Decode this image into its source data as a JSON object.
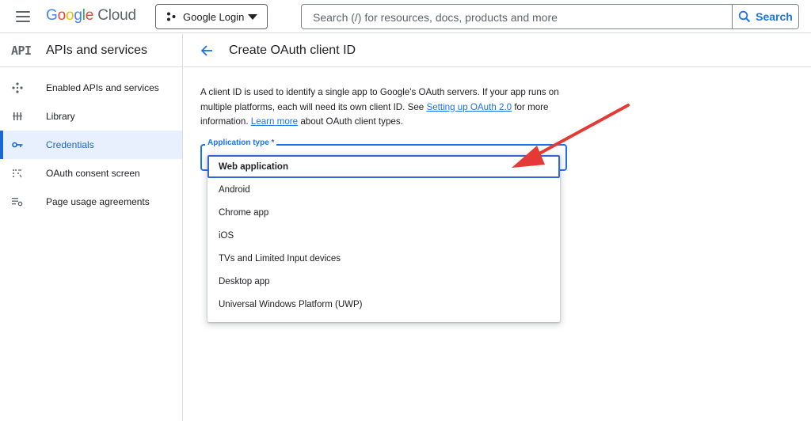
{
  "header": {
    "logo": {
      "g": "G",
      "o1": "o",
      "o2": "o",
      "g2": "g",
      "l": "l",
      "e": "e",
      "cloud": "Cloud"
    },
    "project": "Google Login",
    "search_placeholder": "Search (/) for resources, docs, products and more",
    "search_button": "Search"
  },
  "sidebar": {
    "badge": "API",
    "title": "APIs and services",
    "items": [
      {
        "label": "Enabled APIs and services",
        "icon": "diamond-nodes-icon"
      },
      {
        "label": "Library",
        "icon": "library-icon"
      },
      {
        "label": "Credentials",
        "icon": "key-icon",
        "active": true
      },
      {
        "label": "OAuth consent screen",
        "icon": "consent-icon"
      },
      {
        "label": "Page usage agreements",
        "icon": "settings-list-icon"
      }
    ]
  },
  "main": {
    "title": "Create OAuth client ID",
    "desc_1": "A client ID is used to identify a single app to Google's OAuth servers. If your app runs on multiple platforms, each will need its own client ID. See ",
    "desc_link_1": "Setting up OAuth 2.0",
    "desc_2": " for more information. ",
    "desc_link_2": "Learn more",
    "desc_3": " about OAuth client types.",
    "field_label": "Application type *",
    "options": [
      "Web application",
      "Android",
      "Chrome app",
      "iOS",
      "TVs and Limited Input devices",
      "Desktop app",
      "Universal Windows Platform (UWP)"
    ],
    "selected_index": 0
  },
  "colors": {
    "accent": "#1a73e8",
    "active_bg": "#e8f0fe",
    "annotation_arrow": "#e53935"
  }
}
